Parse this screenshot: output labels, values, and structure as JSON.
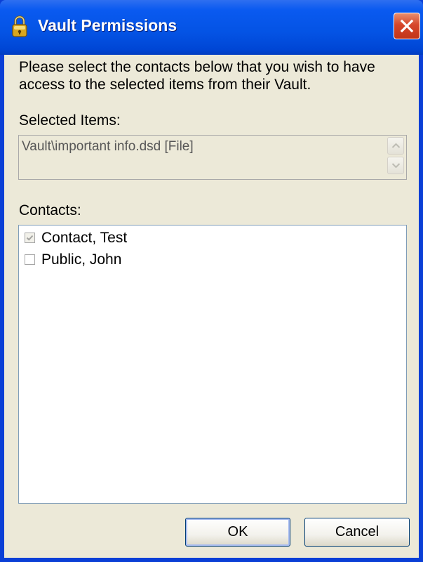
{
  "window": {
    "title": "Vault Permissions",
    "icon": "lock-icon",
    "close_icon": "close-icon"
  },
  "dialog": {
    "instruction": "Please select the contacts below that you wish to have access to the selected items from their Vault.",
    "selected_items_label": "Selected Items:",
    "selected_items": [
      "Vault\\important info.dsd [File]"
    ],
    "contacts_label": "Contacts:",
    "contacts": [
      {
        "name": "Contact, Test",
        "checked": true,
        "disabled": true
      },
      {
        "name": "Public, John",
        "checked": false,
        "disabled": false
      }
    ],
    "ok_label": "OK",
    "cancel_label": "Cancel"
  },
  "colors": {
    "titlebar": "#0453e4",
    "dialog_background": "#ece9d8",
    "close_button": "#d6462a"
  }
}
